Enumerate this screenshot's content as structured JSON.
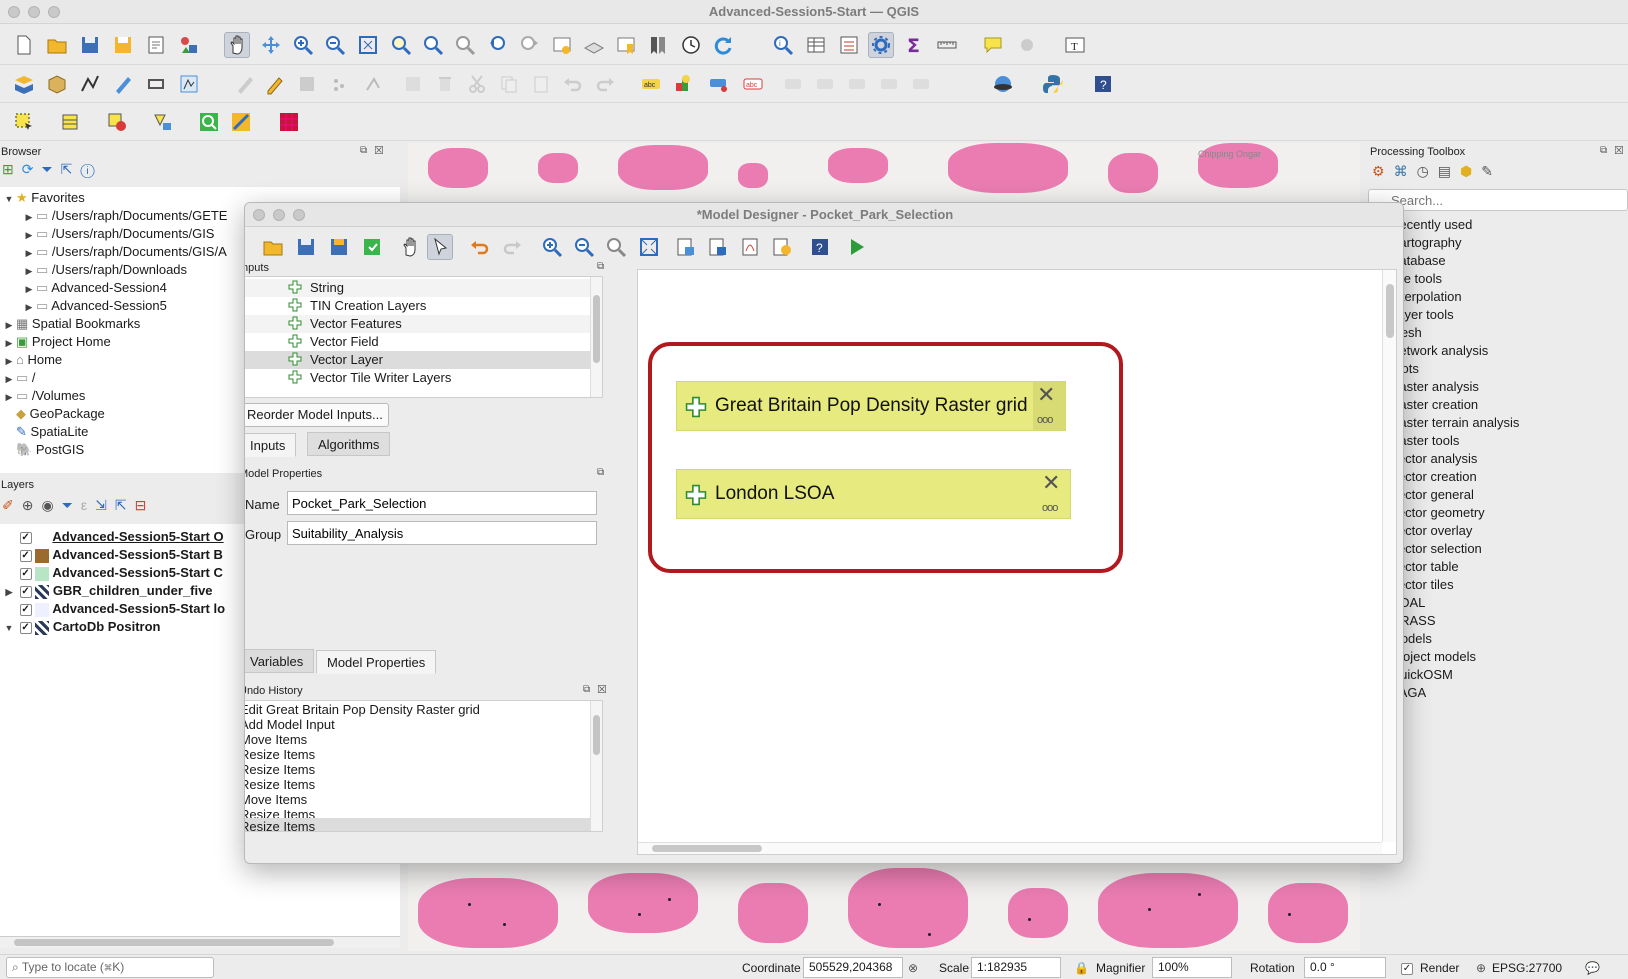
{
  "window": {
    "title": "Advanced-Session5-Start — QGIS"
  },
  "browser": {
    "title": "Browser",
    "items": [
      {
        "label": "Favorites"
      },
      {
        "label": "/Users/raph/Documents/GETE"
      },
      {
        "label": "/Users/raph/Documents/GIS"
      },
      {
        "label": "/Users/raph/Documents/GIS/A"
      },
      {
        "label": "/Users/raph/Downloads"
      },
      {
        "label": "Advanced-Session4"
      },
      {
        "label": "Advanced-Session5"
      },
      {
        "label": "Spatial Bookmarks"
      },
      {
        "label": "Project Home"
      },
      {
        "label": "Home"
      },
      {
        "label": "/"
      },
      {
        "label": "/Volumes"
      },
      {
        "label": "GeoPackage"
      },
      {
        "label": "SpatiaLite"
      },
      {
        "label": "PostGIS"
      }
    ]
  },
  "layers": {
    "title": "Layers",
    "items": [
      {
        "label": "Advanced-Session5-Start O",
        "swatch": "#ffffff"
      },
      {
        "label": "Advanced-Session5-Start B",
        "swatch": "#9b6b2e"
      },
      {
        "label": "Advanced-Session5-Start C",
        "swatch": "#b6e6c3"
      },
      {
        "label": "GBR_children_under_five",
        "swatch": "raster"
      },
      {
        "label": "Advanced-Session5-Start lo",
        "swatch": "#eef0ff"
      },
      {
        "label": "CartoDb Positron",
        "swatch": "raster"
      }
    ]
  },
  "designer": {
    "title": "*Model Designer - Pocket_Park_Selection",
    "inputs_title": "Inputs",
    "inputs": [
      {
        "label": "String"
      },
      {
        "label": "TIN Creation Layers"
      },
      {
        "label": "Vector Features"
      },
      {
        "label": "Vector Field"
      },
      {
        "label": "Vector Layer"
      },
      {
        "label": "Vector Tile Writer Layers"
      }
    ],
    "reorder_label": "Reorder Model Inputs...",
    "tabs": {
      "inputs": "Inputs",
      "algorithms": "Algorithms"
    },
    "props_title": "Model Properties",
    "name_label": "Name",
    "name_value": "Pocket_Park_Selection",
    "group_label": "Group",
    "group_value": "Suitability_Analysis",
    "bottom_tabs": {
      "variables": "Variables",
      "model_properties": "Model Properties"
    },
    "undo_title": "Undo History",
    "undo": [
      {
        "label": "Edit Great Britain Pop Density Raster grid"
      },
      {
        "label": "Add Model Input"
      },
      {
        "label": "Move Items"
      },
      {
        "label": "Resize Items"
      },
      {
        "label": "Resize Items"
      },
      {
        "label": "Resize Items"
      },
      {
        "label": "Move Items"
      },
      {
        "label": "Resize Items"
      },
      {
        "label": "Resize Items"
      }
    ],
    "nodes": [
      {
        "label": "Great Britain Pop Density Raster grid"
      },
      {
        "label": "London LSOA"
      }
    ],
    "highlight_color": "#b0191e"
  },
  "processing": {
    "title": "Processing Toolbox",
    "search_placeholder": "Search...",
    "items": [
      {
        "label": "Recently used"
      },
      {
        "label": "Cartography"
      },
      {
        "label": "Database"
      },
      {
        "label": "File tools"
      },
      {
        "label": "Interpolation"
      },
      {
        "label": "Layer tools"
      },
      {
        "label": "Mesh"
      },
      {
        "label": "Network analysis"
      },
      {
        "label": "Plots"
      },
      {
        "label": "Raster analysis"
      },
      {
        "label": "Raster creation"
      },
      {
        "label": "Raster terrain analysis"
      },
      {
        "label": "Raster tools"
      },
      {
        "label": "Vector analysis"
      },
      {
        "label": "Vector creation"
      },
      {
        "label": "Vector general"
      },
      {
        "label": "Vector geometry"
      },
      {
        "label": "Vector overlay"
      },
      {
        "label": "Vector selection"
      },
      {
        "label": "Vector table"
      },
      {
        "label": "Vector tiles"
      },
      {
        "label": "GDAL"
      },
      {
        "label": "GRASS"
      },
      {
        "label": "Models"
      },
      {
        "label": "Project models"
      },
      {
        "label": "QuickOSM"
      },
      {
        "label": "SAGA"
      }
    ]
  },
  "statusbar": {
    "locate_placeholder": "Type to locate (⌘K)",
    "coordinate_label": "Coordinate",
    "coordinate_value": "505529,204368",
    "scale_label": "Scale",
    "scale_value": "1:182935",
    "magnifier_label": "Magnifier",
    "magnifier_value": "100%",
    "rotation_label": "Rotation",
    "rotation_value": "0.0 °",
    "render_label": "Render",
    "crs": "EPSG:27700"
  },
  "map_labels": {
    "place1": "Chipping Ongar"
  },
  "colors": {
    "accent_green": "#2e8b2e",
    "node_fill": "#e7ea7e",
    "map_pink": "#e7559d"
  }
}
